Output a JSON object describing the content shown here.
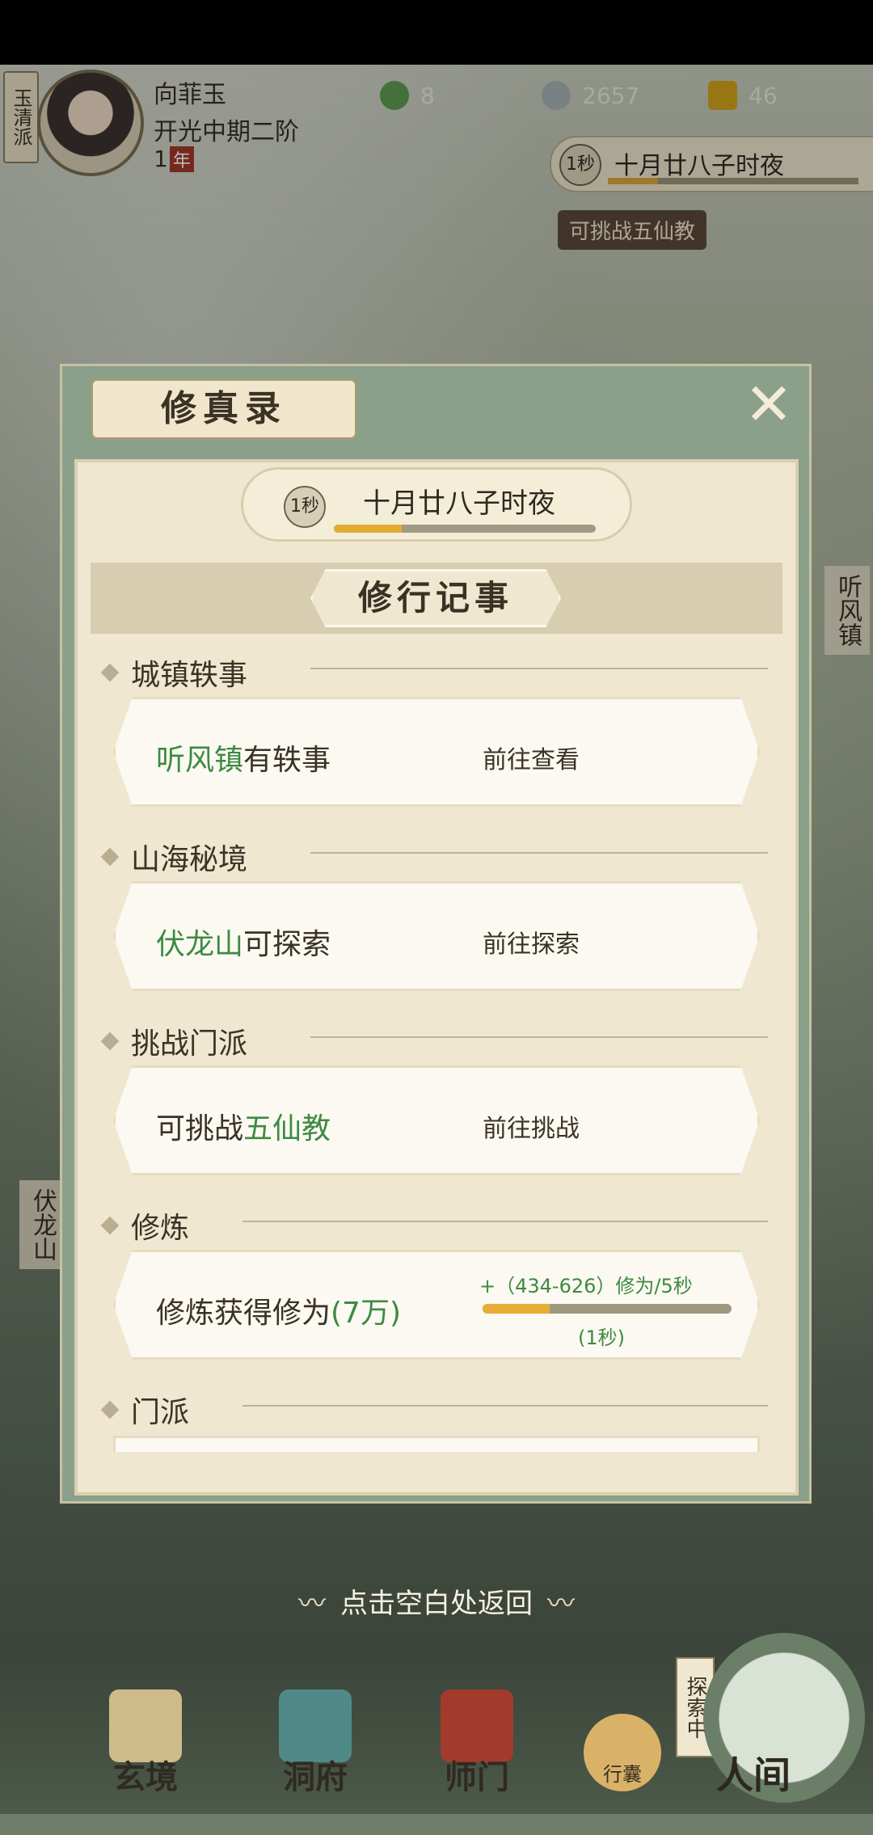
{
  "player": {
    "sect": "玉清派",
    "name": "向菲玉",
    "rank": "开光中期二阶",
    "year_num": "1",
    "year_unit": "年"
  },
  "resources": {
    "jade": "8",
    "coins": "2657",
    "strength": "46"
  },
  "top_time": {
    "icon_label": "1秒",
    "date": "十月廿八子时夜",
    "progress": 0.2
  },
  "map": {
    "challenge_tag": "可挑战五仙教",
    "town_label": "听风镇",
    "mountain_label": "伏龙山"
  },
  "modal": {
    "title": "修真录",
    "clock_label": "1秒",
    "date": "十月廿八子时夜",
    "date_progress": 0.26,
    "section_title": "修行记事",
    "categories": [
      {
        "title": "城镇轶事",
        "card": {
          "highlight": "听风镇",
          "text": "有轶事",
          "action": "前往查看"
        }
      },
      {
        "title": "山海秘境",
        "card": {
          "highlight": "伏龙山",
          "text": "可探索",
          "action": "前往探索"
        }
      },
      {
        "title": "挑战门派",
        "card": {
          "prefix": "可挑战",
          "highlight": "五仙教",
          "action": "前往挑战"
        }
      },
      {
        "title": "修炼",
        "card": {
          "text": "修炼获得修为",
          "highlight": "(7万)",
          "rate": "+（434-626）修为/5秒",
          "progress": 0.27,
          "sub": "(1秒)"
        }
      },
      {
        "title": "门派"
      }
    ]
  },
  "hint": "点击空白处返回",
  "nav": {
    "xuanjing": "玄境",
    "dongfu": "洞府",
    "shimen": "师门",
    "bag": "行囊",
    "renjian": "人间",
    "explore_tag": "探索中"
  }
}
